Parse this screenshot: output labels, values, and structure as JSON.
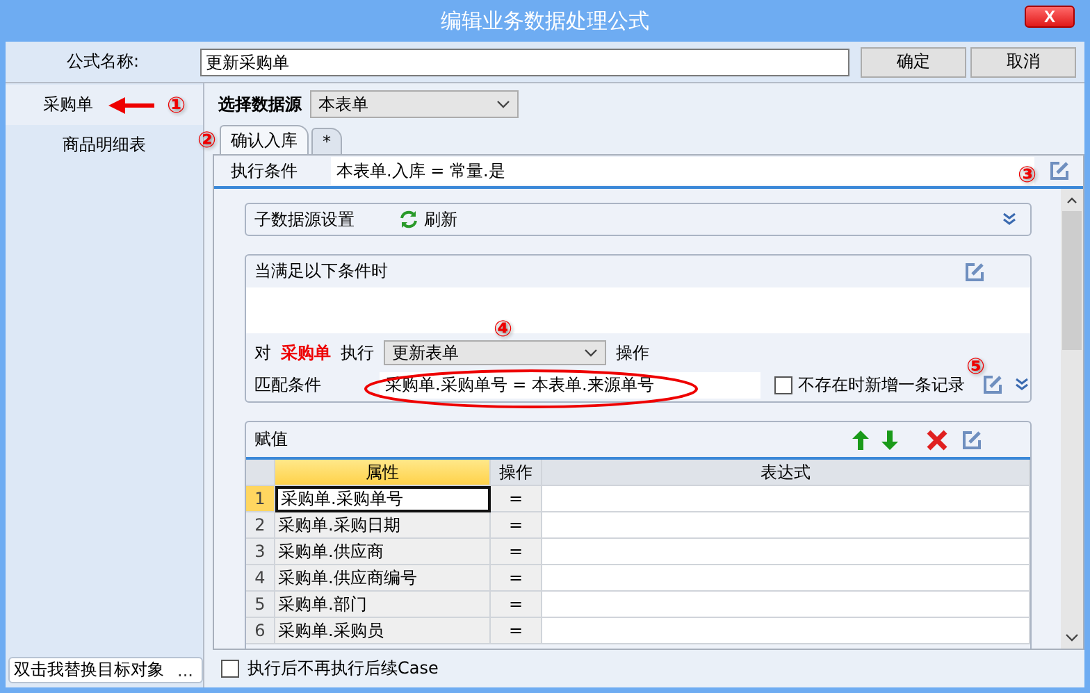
{
  "window": {
    "title": "编辑业务数据处理公式",
    "close": "X"
  },
  "formula": {
    "label": "公式名称:",
    "value": "更新采购单"
  },
  "buttons": [
    "确定",
    "取消"
  ],
  "sidebar": {
    "items": [
      {
        "label": "采购单",
        "selected": true
      },
      {
        "label": "商品明细表",
        "selected": false
      }
    ],
    "replace_field": {
      "value": "双击我替换目标对象",
      "button": "..."
    }
  },
  "datasource": {
    "label": "选择数据源",
    "value": "本表单"
  },
  "tabs": [
    {
      "label": "确认入库",
      "selected": true
    },
    {
      "label": "*",
      "selected": false
    }
  ],
  "condition": {
    "label": "执行条件",
    "value": "本表单.入库 = 常量.是"
  },
  "sub_source": {
    "label": "子数据源设置",
    "refresh": "刷新"
  },
  "when": {
    "label": "当满足以下条件时",
    "target_prefix": "对",
    "target": "采购单",
    "exec": "执行",
    "action": "更新表单",
    "op": "操作",
    "match_label": "匹配条件",
    "match_value": "采购单.采购单号 = 本表单.来源单号",
    "insert": {
      "label": "不存在时新增一条记录",
      "checked": false
    }
  },
  "assign": {
    "title": "赋值",
    "columns": [
      "属性",
      "操作",
      "表达式"
    ],
    "rows": [
      {
        "num": "1",
        "property": "采购单.采购单号",
        "op": "=",
        "selected": true
      },
      {
        "num": "2",
        "property": "采购单.采购日期",
        "op": "=",
        "selected": false
      },
      {
        "num": "3",
        "property": "采购单.供应商",
        "op": "=",
        "selected": false
      },
      {
        "num": "4",
        "property": "采购单.供应商编号",
        "op": "=",
        "selected": false
      },
      {
        "num": "5",
        "property": "采购单.部门",
        "op": "=",
        "selected": false
      },
      {
        "num": "6",
        "property": "采购单.采购员",
        "op": "=",
        "selected": false
      }
    ]
  },
  "stop_after": {
    "label": "执行后不再执行后续Case",
    "checked": false
  },
  "annotations": [
    "①",
    "②",
    "③",
    "④",
    "⑤"
  ]
}
